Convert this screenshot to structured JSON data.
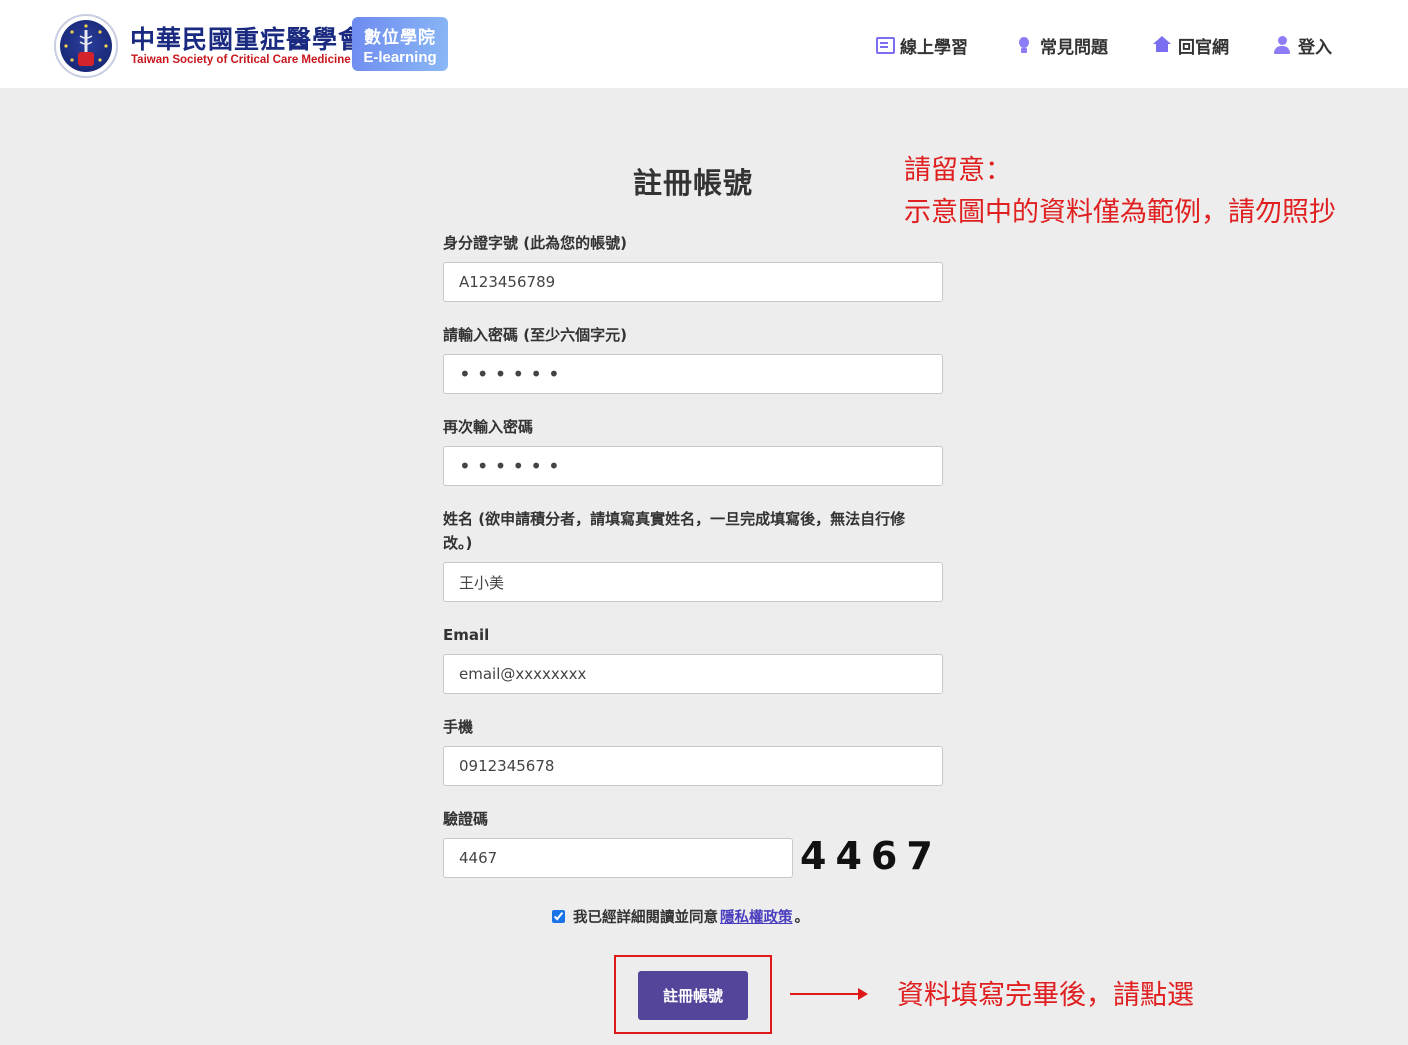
{
  "header": {
    "org_name": "中華民國重症醫學會",
    "org_name_en": "Taiwan Society of Critical Care Medicine",
    "badge_zh": "數位學院",
    "badge_en": "E-learning",
    "nav": [
      {
        "label": "線上學習",
        "icon": "online-learning-icon"
      },
      {
        "label": "常見問題",
        "icon": "lightbulb-icon"
      },
      {
        "label": "回官網",
        "icon": "home-icon"
      },
      {
        "label": "登入",
        "icon": "user-icon"
      }
    ]
  },
  "form": {
    "title": "註冊帳號",
    "id_label": "身分證字號 (此為您的帳號)",
    "id_value": "A123456789",
    "password_label": "請輸入密碼 (至少六個字元)",
    "password_value": "123456",
    "confirm_label": "再次輸入密碼",
    "confirm_value": "123456",
    "name_label_line1": "姓名 (欲申請積分者，請填寫真實姓名，一旦完成填寫後，無法自行修",
    "name_label_line2": "改。)",
    "name_value": "王小美",
    "email_label": "Email",
    "email_value": "email@xxxxxxxx",
    "phone_label": "手機",
    "phone_value": "0912345678",
    "captcha_label": "驗證碼",
    "captcha_value": "4467",
    "captcha_image_text": "4467",
    "agree_text": "我已經詳細閱讀並同意",
    "agree_link": "隱私權政策",
    "agree_suffix": "。",
    "agree_checked": true,
    "submit_label": "註冊帳號"
  },
  "annotations": {
    "note_line1": "請留意：",
    "note_line2": "示意圖中的資料僅為範例，請勿照抄",
    "submit_hint": "資料填寫完畢後，請點選",
    "color": "#e02020"
  }
}
